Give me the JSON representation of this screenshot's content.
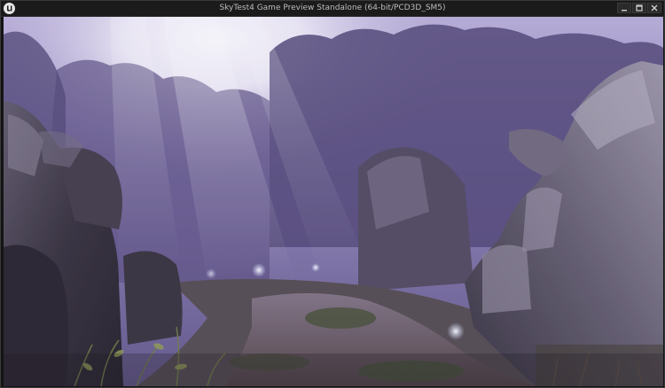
{
  "window": {
    "title": "SkyTest4 Game Preview Standalone (64-bit/PCD3D_SM5)",
    "logo_icon": "unreal-engine-logo-icon",
    "controls": {
      "minimize_icon": "minimize-icon",
      "maximize_icon": "maximize-icon",
      "close_icon": "close-icon"
    }
  },
  "viewport": {
    "scene": "game-render",
    "colors": {
      "sky": "#f2eef8",
      "haze": "#9d92c8",
      "forest": "#3d3460",
      "rock_dark": "#2a2530",
      "rock_light": "#8a8496",
      "path": "#5a4d4a",
      "grass": "#3e4a2c"
    }
  }
}
